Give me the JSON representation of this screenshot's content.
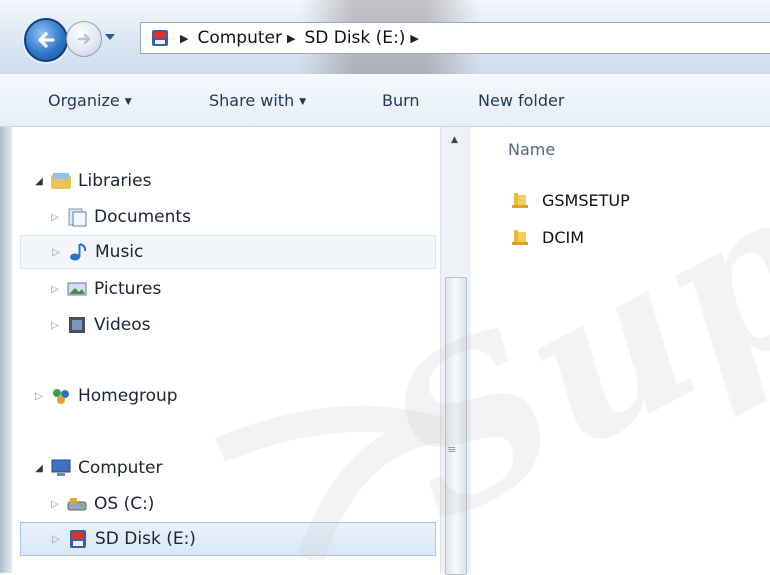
{
  "address": {
    "crumbs": [
      "Computer",
      "SD Disk (E:)"
    ]
  },
  "toolbar": {
    "organize": "Organize",
    "share_with": "Share with",
    "burn": "Burn",
    "new_folder": "New folder"
  },
  "nav": {
    "libraries": "Libraries",
    "documents": "Documents",
    "music": "Music",
    "pictures": "Pictures",
    "videos": "Videos",
    "homegroup": "Homegroup",
    "computer": "Computer",
    "os_c": "OS (C:)",
    "sd_disk": "SD Disk (E:)"
  },
  "files": {
    "column_name": "Name",
    "items": [
      "GSMSETUP",
      "DCIM"
    ]
  },
  "watermark": "Sup"
}
